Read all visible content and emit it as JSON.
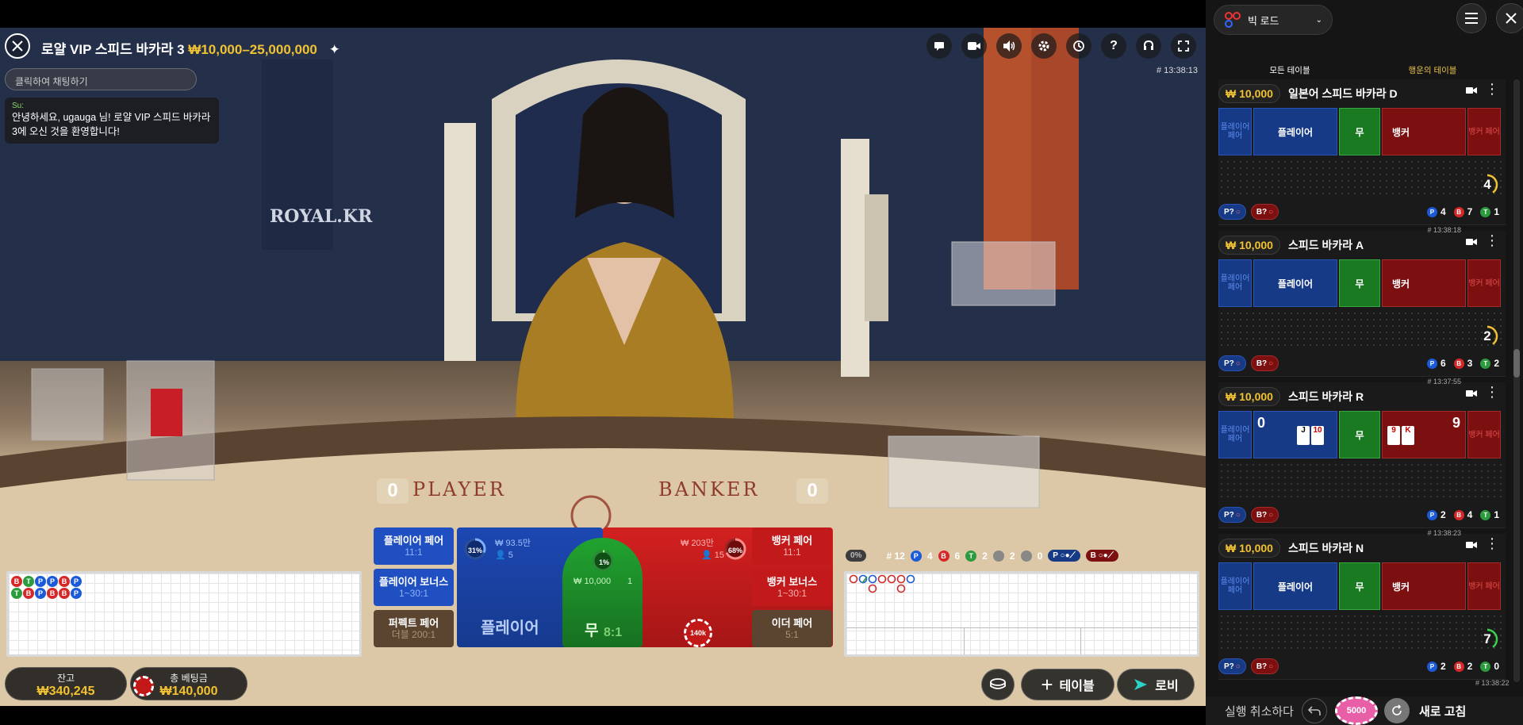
{
  "game": {
    "title": "로얄 VIP 스피드 바카라 3",
    "limits": "₩10,000–25,000,000",
    "chat_placeholder": "클릭하여 채팅하기",
    "chat_user": "Su:",
    "chat_message": "안녕하세요, ugauga 님! 로얄 VIP 스피드 바카라 3에 오신 것을 환영합니다!",
    "round_id": "# 13:38:13",
    "player_score": "0",
    "banker_score": "0",
    "table_text_player": "PLAYER",
    "table_text_banker": "BANKER",
    "logo_text": "ROYAL.KR"
  },
  "icons": [
    "chat-icon",
    "camera-icon",
    "sound-icon",
    "settings-icon",
    "history-icon",
    "help-icon",
    "support-icon",
    "fullscreen-icon"
  ],
  "bead_road": [
    [
      "B",
      "T"
    ],
    [
      "T",
      "B"
    ],
    [
      "P",
      "P"
    ],
    [
      "P",
      "B"
    ],
    [
      "B",
      "B"
    ],
    [
      "P",
      "P"
    ]
  ],
  "betting": {
    "player_pair": {
      "label": "플레이어 페어",
      "odds": "11:1"
    },
    "player_bonus": {
      "label": "플레이어 보너스",
      "odds": "1~30:1"
    },
    "perfect_pair": {
      "label": "퍼펙트 페어",
      "odds": "더블 200:1"
    },
    "banker_pair": {
      "label": "뱅커 페어",
      "odds": "11:1"
    },
    "banker_bonus": {
      "label": "뱅커 보너스",
      "odds": "1~30:1"
    },
    "either_pair": {
      "label": "이더 페어",
      "odds": "5:1"
    },
    "player": {
      "label": "플레이어",
      "amount": "₩ 93.5만",
      "players": "5",
      "pct": "31%",
      "pct_value": 31
    },
    "tie": {
      "label": "무",
      "odds": "8:1",
      "amount": "₩ 10,000",
      "players": "1",
      "pct": "1%",
      "pct_value": 1
    },
    "banker": {
      "amount": "₩ 203만",
      "players": "15",
      "pct": "68%",
      "pct_value": 68
    },
    "chip_on_banker": "140k"
  },
  "stats": {
    "pct_badge": "0%",
    "total_label": "# 12",
    "player": "4",
    "banker": "6",
    "tie": "2",
    "p_pair": "2",
    "b_pair": "0",
    "ask_player": "P",
    "ask_banker": "B"
  },
  "wallet": {
    "balance_label": "잔고",
    "balance": "₩340,245",
    "total_bet_label": "총 베팅금",
    "total_bet": "₩140,000"
  },
  "actions": {
    "add_table": "테이블",
    "lobby": "로비"
  },
  "sidebar": {
    "road_selector": "빅 로드",
    "tab_all": "모든 테이블",
    "tab_lucky": "행운의 테이블",
    "tables": [
      {
        "min": "₩ 10,000",
        "name": "일본어 스피드 바카라 D",
        "time": "",
        "p_pair": "플레이어 페어",
        "player": "플레이어",
        "tie": "무",
        "banker": "뱅커",
        "b_pair": "뱅커 페어",
        "count": "4",
        "p": "4",
        "b": "7",
        "t": "1",
        "ask_p": "P?",
        "ask_b": "B?",
        "p_score": "",
        "b_score": ""
      },
      {
        "min": "₩ 10,000",
        "name": "스피드 바카라 A",
        "time": "# 13:38:18",
        "p_pair": "플레이어 페어",
        "player": "플레이어",
        "tie": "무",
        "banker": "뱅커",
        "b_pair": "뱅커 페어",
        "count": "2",
        "p": "6",
        "b": "3",
        "t": "2",
        "ask_p": "P?",
        "ask_b": "B?",
        "p_score": "",
        "b_score": ""
      },
      {
        "min": "₩ 10,000",
        "name": "스피드 바카라 R",
        "time": "# 13:37:55",
        "p_pair": "플레이어 페어",
        "player": "",
        "tie": "무",
        "banker": "",
        "b_pair": "뱅커 페어",
        "count": "",
        "p": "2",
        "b": "4",
        "t": "1",
        "ask_p": "P?",
        "ask_b": "B?",
        "p_score": "0",
        "b_score": "9"
      },
      {
        "min": "₩ 10,000",
        "name": "스피드 바카라 N",
        "time": "# 13:38:23",
        "p_pair": "플레이어 페어",
        "player": "플레이어",
        "tie": "무",
        "banker": "뱅커",
        "b_pair": "뱅커 페어",
        "count": "7",
        "p": "2",
        "b": "2",
        "t": "0",
        "ask_p": "P?",
        "ask_b": "B?",
        "p_score": "",
        "b_score": ""
      }
    ],
    "next_time": "# 13:38:22",
    "undo": "실행 취소하다",
    "chip": "5000",
    "refresh": "새로 고침"
  },
  "colors": {
    "player": "#1b4fb8",
    "banker": "#c01a1a",
    "tie": "#1f8a2a",
    "gold": "#f1c232"
  }
}
